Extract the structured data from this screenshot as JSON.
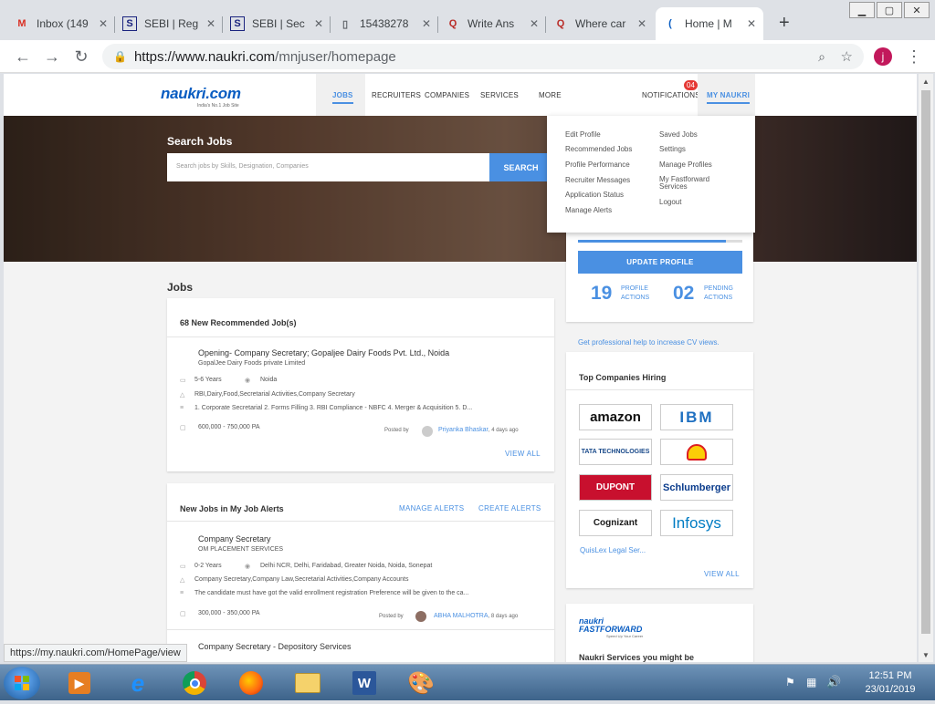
{
  "browser": {
    "tabs": [
      {
        "label": "Inbox (149",
        "icon": "gmail-icon",
        "icon_glyph": "M",
        "icon_color": "#d93025"
      },
      {
        "label": "SEBI | Reg",
        "icon": "sebi-icon",
        "icon_glyph": "S",
        "icon_color": "#1a237e"
      },
      {
        "label": "SEBI | Sec",
        "icon": "sebi-icon",
        "icon_glyph": "S",
        "icon_color": "#1a237e"
      },
      {
        "label": "15438278",
        "icon": "document-icon",
        "icon_glyph": "▯",
        "icon_color": "#5f6368"
      },
      {
        "label": "Write Ans",
        "icon": "quora-icon",
        "icon_glyph": "Q",
        "icon_color": "#b92b27"
      },
      {
        "label": "Where car",
        "icon": "quora-icon",
        "icon_glyph": "Q",
        "icon_color": "#b92b27"
      },
      {
        "label": "Home | M",
        "icon": "naukri-icon",
        "icon_glyph": "(",
        "icon_color": "#0a5dc2"
      }
    ],
    "active_tab": 6,
    "url_host": "https://www.naukri.com",
    "url_path": "/mnjuser/homepage",
    "profile_initial": "j",
    "status_url": "https://my.naukri.com/HomePage/view"
  },
  "site": {
    "logo_text": "naukri.com",
    "logo_tagline": "India's No.1 Job Site",
    "nav": [
      "JOBS",
      "RECRUITERS",
      "COMPANIES",
      "SERVICES",
      "MORE"
    ],
    "notifications_label": "NOTIFICATIONS",
    "notifications_count": "04",
    "my_naukri_label": "MY NAUKRI",
    "accent": "#4a90e2"
  },
  "banner": {
    "title": "Search Jobs",
    "placeholder": "Search jobs by Skills, Designation, Companies",
    "search_button": "SEARCH"
  },
  "dropdown": {
    "col1": [
      "Edit Profile",
      "Recommended Jobs",
      "Profile Performance",
      "Recruiter Messages",
      "Application Status",
      "Manage Alerts"
    ],
    "col2": [
      "Saved Jobs",
      "Settings",
      "Manage Profiles",
      "My Fastforward Services",
      "Logout"
    ]
  },
  "jobs": {
    "section_title": "Jobs",
    "recommended": {
      "header": "68 New Recommended Job(s)",
      "title": "Opening- Company Secretary; Gopaljee Dairy Foods Pvt. Ltd., Noida",
      "company": "GopalJee Dairy Foods private Limited",
      "experience": "5-6 Years",
      "location": "Noida",
      "skills": "RBI,Dairy,Food,Secretarial Activities,Company Secretary",
      "description": "1. Corporate Secretarial 2. Forms Filling 3. RBI Compliance - NBFC 4. Merger & Acquisition 5. D...",
      "salary": "600,000 - 750,000 PA",
      "posted_by_label": "Posted by",
      "posted_by": "Priyanka Bhaskar",
      "posted_ago": ", 4 days ago",
      "view_all": "VIEW ALL"
    },
    "alerts": {
      "header": "New Jobs in My Job Alerts",
      "manage": "MANAGE ALERTS",
      "create": "CREATE ALERTS",
      "title": "Company Secretary",
      "company": "OM PLACEMENT SERVICES",
      "experience": "0-2 Years",
      "location": "Delhi NCR, Delhi, Faridabad, Greater Noida, Noida, Sonepat",
      "skills": "Company Secretary,Company Law,Secretarial Activities,Company Accounts",
      "description": "The candidate must have got the valid enrollment registration Preference will be given to the ca...",
      "salary": "300,000 - 350,000 PA",
      "posted_by_label": "Posted by",
      "posted_by": "ABHA MALHOTRA",
      "posted_ago": ", 8 days ago",
      "next_title": "Company Secretary - Depository Services"
    }
  },
  "profile": {
    "completion": 0.9,
    "update_button": "UPDATE PROFILE",
    "profile_actions_count": "19",
    "profile_actions_label1": "PROFILE",
    "profile_actions_label2": "ACTIONS",
    "pending_actions_count": "02",
    "pending_actions_label1": "PENDING",
    "pending_actions_label2": "ACTIONS",
    "cv_help": "Get professional help to increase CV views."
  },
  "companies": {
    "header": "Top Companies Hiring",
    "logos": [
      {
        "name": "amazon",
        "color": "#111",
        "bg": "#fff"
      },
      {
        "name": "IBM",
        "color": "#1f70c1",
        "bg": "#fff"
      },
      {
        "name": "TATA TECHNOLOGIES",
        "color": "#1a4a8a",
        "bg": "#fff"
      },
      {
        "name": "Shell",
        "color": "#dd1d21",
        "bg": "#fff"
      },
      {
        "name": "DUPONT",
        "color": "#fff",
        "bg": "#c8102e"
      },
      {
        "name": "Schlumberger",
        "color": "#0b3c8c",
        "bg": "#fff"
      },
      {
        "name": "Cognizant",
        "color": "#1a1a1a",
        "bg": "#fff"
      },
      {
        "name": "Infosys",
        "color": "#007cc3",
        "bg": "#fff"
      }
    ],
    "extra": "QuisLex Legal Ser...",
    "view_all": "VIEW ALL"
  },
  "fastforward": {
    "brand1": "naukri",
    "brand2": "FASTFORWARD",
    "tagline": "Speed Up Your Career",
    "services_title": "Naukri Services you might be"
  },
  "taskbar": {
    "time": "12:51 PM",
    "date": "23/01/2019"
  }
}
